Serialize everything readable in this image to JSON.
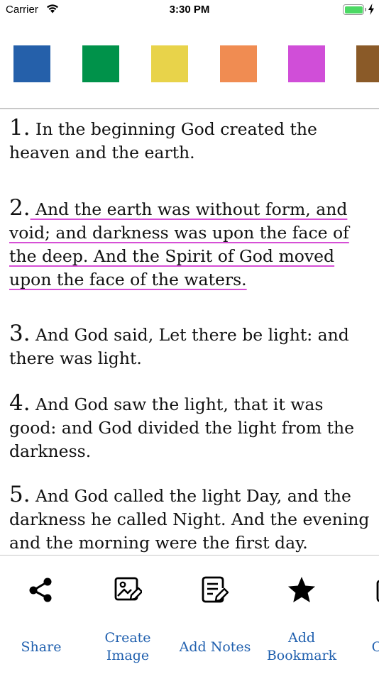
{
  "status_bar": {
    "carrier": "Carrier",
    "time": "3:30 PM",
    "battery_color": "#4cd964"
  },
  "highlight_colors": [
    "#2560aa",
    "#00924a",
    "#e8d34a",
    "#f08c52",
    "#d04ed8",
    "#8a5a28"
  ],
  "verses": [
    {
      "number": "1.",
      "text": " In the beginning God created the heaven and the earth.",
      "highlighted": false
    },
    {
      "number": "2.",
      "text": " And the earth was without form, and void; and darkness was upon the face of the deep. And the Spirit of God moved upon the face of the waters.",
      "highlighted": true,
      "highlight_color": "#d64fd6"
    },
    {
      "number": "3.",
      "text": " And God said, Let there be light: and there was light.",
      "highlighted": false
    },
    {
      "number": "4.",
      "text": " And God saw the light, that it was good: and God divided the light from the darkness.",
      "highlighted": false
    },
    {
      "number": "5.",
      "text": " And God called the light Day, and the darkness he called Night. And the evening and the morning were the first day.",
      "highlighted": false
    }
  ],
  "toolbar": {
    "label_color": "#1f5fae",
    "items": [
      {
        "label": "Share",
        "icon": "share-icon"
      },
      {
        "label": "Create Image",
        "icon": "create-image-icon"
      },
      {
        "label": "Add Notes",
        "icon": "add-notes-icon"
      },
      {
        "label": "Add Bookmark",
        "icon": "star-icon"
      },
      {
        "label": "Copy",
        "icon": "copy-icon"
      }
    ]
  }
}
